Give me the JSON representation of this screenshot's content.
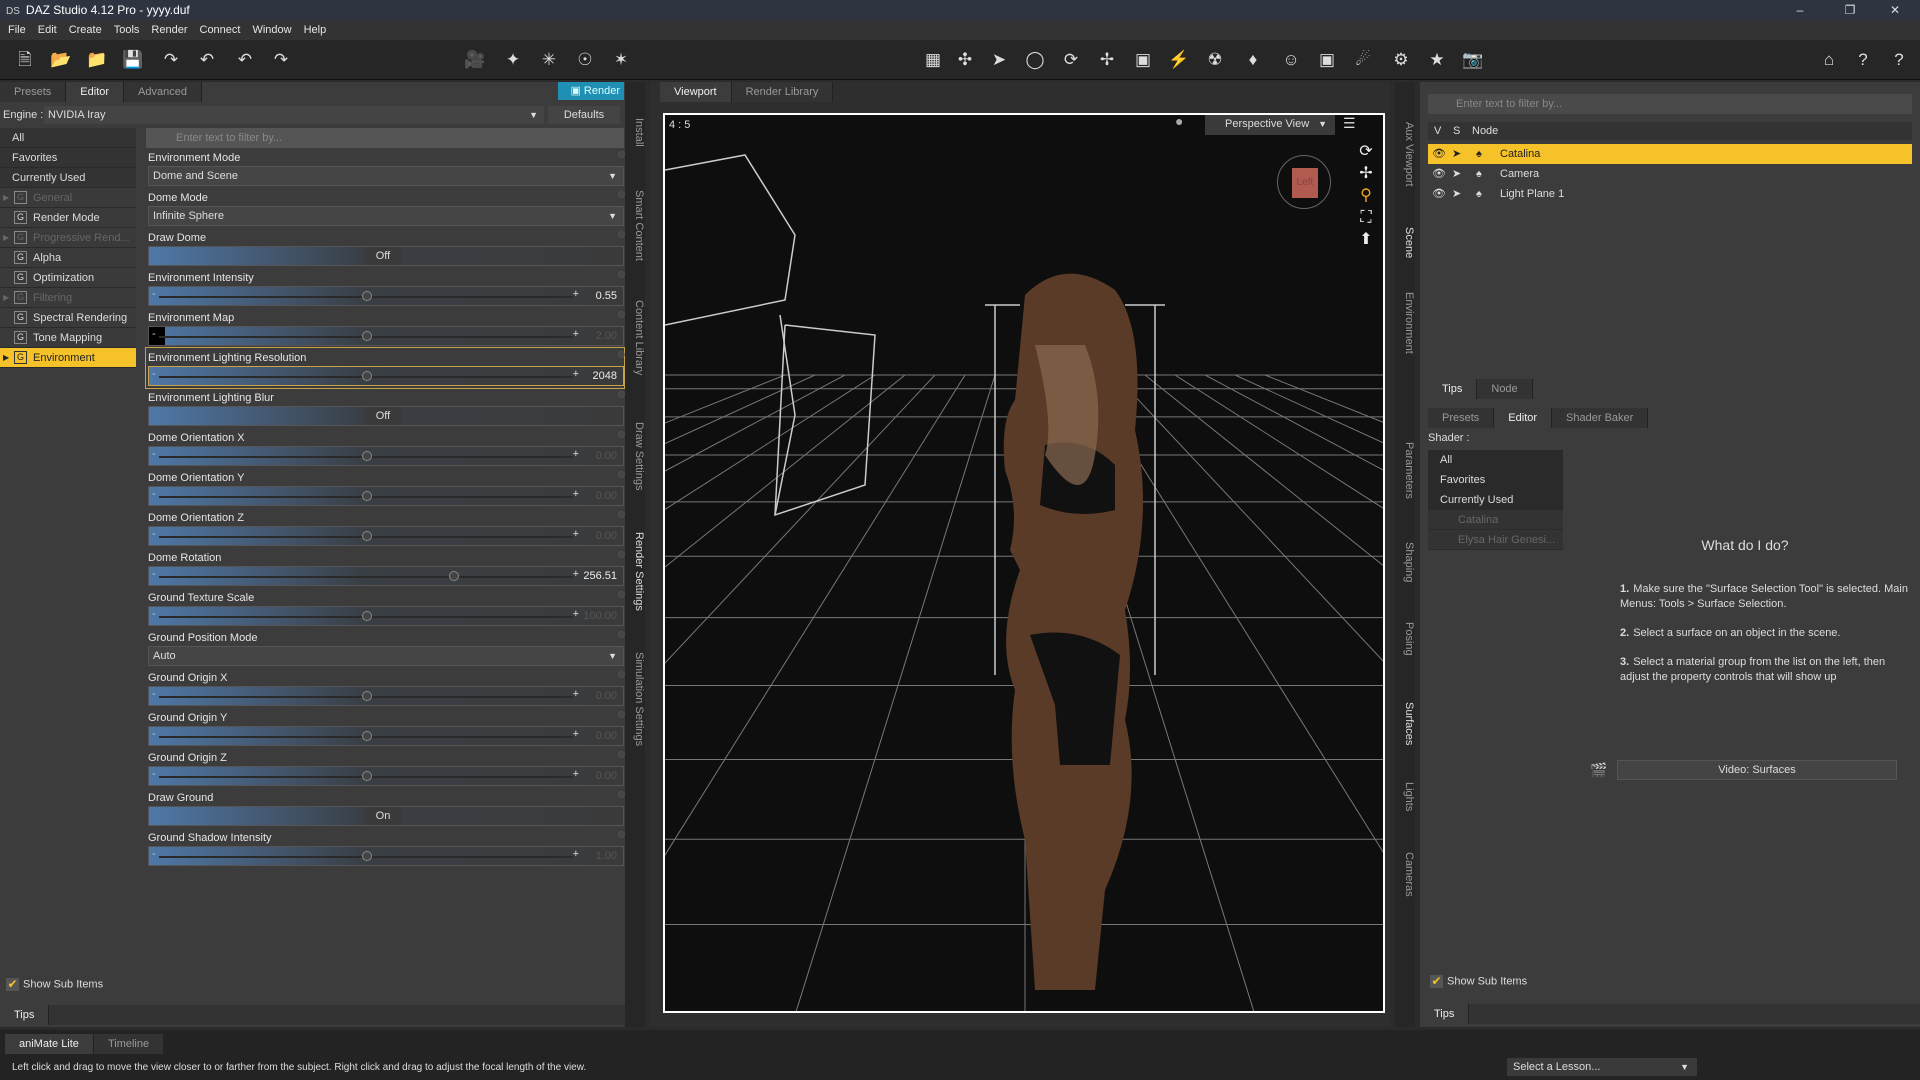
{
  "window": {
    "title": "DAZ Studio 4.12 Pro - yyyy.duf",
    "logo": "DS"
  },
  "menu": [
    "File",
    "Edit",
    "Create",
    "Tools",
    "Render",
    "Connect",
    "Window",
    "Help"
  ],
  "toolbar_icons": [
    "new-file-icon",
    "open-icon",
    "merge-icon",
    "save-icon",
    "import-icon",
    "export-icon",
    "undo-icon",
    "redo-icon",
    "new-camera-icon",
    "new-spotlight-icon",
    "new-pointlight-icon",
    "new-distantlight-icon",
    "new-light-icon"
  ],
  "left_panel": {
    "tabs": [
      "Presets",
      "Editor",
      "Advanced"
    ],
    "active_tab": "Editor",
    "render_label": "Render",
    "engine_label": "Engine :",
    "engine_value": "NVIDIA Iray",
    "defaults_label": "Defaults",
    "filter_placeholder": "Enter text to filter by...",
    "categories": [
      {
        "label": "All",
        "type": "plain"
      },
      {
        "label": "Favorites",
        "type": "plain"
      },
      {
        "label": "Currently Used",
        "type": "plain"
      },
      {
        "label": "General",
        "type": "group",
        "dim": true,
        "expand": true
      },
      {
        "label": "Render Mode",
        "type": "group"
      },
      {
        "label": "Progressive Rend...",
        "type": "group",
        "dim": true,
        "expand": true
      },
      {
        "label": "Alpha",
        "type": "group"
      },
      {
        "label": "Optimization",
        "type": "group"
      },
      {
        "label": "Filtering",
        "type": "group",
        "dim": true,
        "expand": true
      },
      {
        "label": "Spectral Rendering",
        "type": "group"
      },
      {
        "label": "Tone Mapping",
        "type": "group"
      },
      {
        "label": "Environment",
        "type": "group",
        "selected": true,
        "expand": true
      }
    ],
    "properties": [
      {
        "label": "Environment Mode",
        "kind": "select",
        "value": "Dome and Scene"
      },
      {
        "label": "Dome Mode",
        "kind": "select",
        "value": "Infinite Sphere"
      },
      {
        "label": "Draw Dome",
        "kind": "toggle",
        "value": "Off"
      },
      {
        "label": "Environment Intensity",
        "kind": "slider",
        "value": "0.55",
        "pos": 0.5
      },
      {
        "label": "Environment Map",
        "kind": "slider",
        "value": "2.00",
        "pos": 0.5,
        "dim": true,
        "map": true
      },
      {
        "label": "Environment Lighting Resolution",
        "kind": "slider",
        "value": "2048",
        "pos": 0.5,
        "highlight": true
      },
      {
        "label": "Environment Lighting Blur",
        "kind": "toggle",
        "value": "Off"
      },
      {
        "label": "Dome Orientation X",
        "kind": "slider",
        "value": "0.00",
        "pos": 0.5,
        "dim": true
      },
      {
        "label": "Dome Orientation Y",
        "kind": "slider",
        "value": "0.00",
        "pos": 0.5,
        "dim": true
      },
      {
        "label": "Dome Orientation Z",
        "kind": "slider",
        "value": "0.00",
        "pos": 0.5,
        "dim": true
      },
      {
        "label": "Dome Rotation",
        "kind": "slider",
        "value": "256.51",
        "pos": 0.71
      },
      {
        "label": "Ground Texture Scale",
        "kind": "slider",
        "value": "100.00",
        "pos": 0.5,
        "dim": true
      },
      {
        "label": "Ground Position Mode",
        "kind": "select",
        "value": "Auto"
      },
      {
        "label": "Ground Origin X",
        "kind": "slider",
        "value": "0.00",
        "pos": 0.5,
        "dim": true
      },
      {
        "label": "Ground Origin Y",
        "kind": "slider",
        "value": "0.00",
        "pos": 0.5,
        "dim": true
      },
      {
        "label": "Ground Origin Z",
        "kind": "slider",
        "value": "0.00",
        "pos": 0.5,
        "dim": true
      },
      {
        "label": "Draw Ground",
        "kind": "toggle",
        "value": "On"
      },
      {
        "label": "Ground Shadow Intensity",
        "kind": "slider",
        "value": "1.00",
        "pos": 0.5,
        "dim": true
      }
    ],
    "show_sub_items": "Show Sub Items",
    "tips": "Tips"
  },
  "left_strip": [
    "Install",
    "Smart Content",
    "Content Library",
    "Draw Settings",
    "Render Settings",
    "Simulation Settings"
  ],
  "viewport": {
    "tabs": [
      "Viewport",
      "Render Library"
    ],
    "aspect": "4 : 5",
    "view": "Perspective View",
    "cube_label": "Left"
  },
  "right_strip_top": [
    "Aux Viewport",
    "Scene",
    "Environment"
  ],
  "right_strip_bottom": [
    "Parameters",
    "Shaping",
    "Posing",
    "Surfaces",
    "Lights",
    "Cameras"
  ],
  "scene": {
    "filter_placeholder": "Enter text to filter by...",
    "columns": [
      "V",
      "S",
      "Node"
    ],
    "nodes": [
      {
        "label": "Catalina",
        "selected": true
      },
      {
        "label": "Camera"
      },
      {
        "label": "Light Plane 1"
      }
    ],
    "tabs": [
      "Tips",
      "Node"
    ]
  },
  "surfaces": {
    "tabs": [
      "Presets",
      "Editor",
      "Shader Baker"
    ],
    "shader_label": "Shader :",
    "list": [
      "All",
      "Favorites",
      "Currently Used"
    ],
    "tree": [
      "Catalina",
      "Elysa Hair Genesi..."
    ],
    "help_title": "What do I do?",
    "steps": [
      {
        "num": "1.",
        "text": "Make sure the \"Surface Selection Tool\" is selected. Main Menus: Tools > Surface Selection."
      },
      {
        "num": "2.",
        "text": "Select a surface on an object in the scene."
      },
      {
        "num": "3.",
        "text": "Select a material group from the list on the left, then adjust the property controls that will show up"
      }
    ],
    "video_button": "Video: Surfaces",
    "show_sub_items": "Show Sub Items",
    "tips": "Tips"
  },
  "bottom": {
    "tabs": [
      "aniMate Lite",
      "Timeline"
    ],
    "status": "Left click and drag to move the view closer to or farther from the subject. Right click and drag to adjust the focal length of the view.",
    "lesson": "Select a Lesson..."
  },
  "colors": {
    "accent": "#f5c22a",
    "render": "#1f8fb3"
  }
}
